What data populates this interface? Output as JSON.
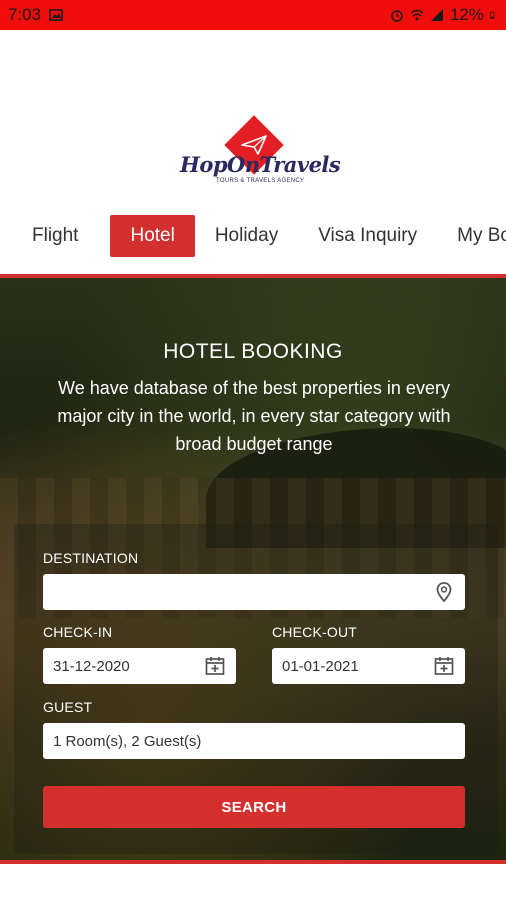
{
  "status_bar": {
    "time": "7:03",
    "battery": "12%",
    "icons": [
      "image-icon",
      "alarm-icon",
      "wifi-icon",
      "signal-icon",
      "battery-icon"
    ]
  },
  "logo": {
    "name": "HopOnTravels",
    "tagline": "TOURS & TRAVELS AGENCY"
  },
  "tabs": [
    {
      "label": "Flight",
      "active": false
    },
    {
      "label": "Hotel",
      "active": true
    },
    {
      "label": "Holiday",
      "active": false
    },
    {
      "label": "Visa Inquiry",
      "active": false
    },
    {
      "label": "My Boo",
      "active": false
    }
  ],
  "hero": {
    "title": "HOTEL BOOKING",
    "description": "We have database of the best properties in every major city in the world, in every star category with broad budget range"
  },
  "form": {
    "destination_label": "DESTINATION",
    "destination_value": "",
    "checkin_label": "CHECK-IN",
    "checkin_value": "31-12-2020",
    "checkout_label": "CHECK-OUT",
    "checkout_value": "01-01-2021",
    "guest_label": "GUEST",
    "guest_value": "1 Room(s), 2 Guest(s)",
    "search_label": "SEARCH"
  },
  "colors": {
    "status_bar": "#f20d0d",
    "accent": "#d32f2f",
    "logo_text": "#2b2a5e"
  }
}
